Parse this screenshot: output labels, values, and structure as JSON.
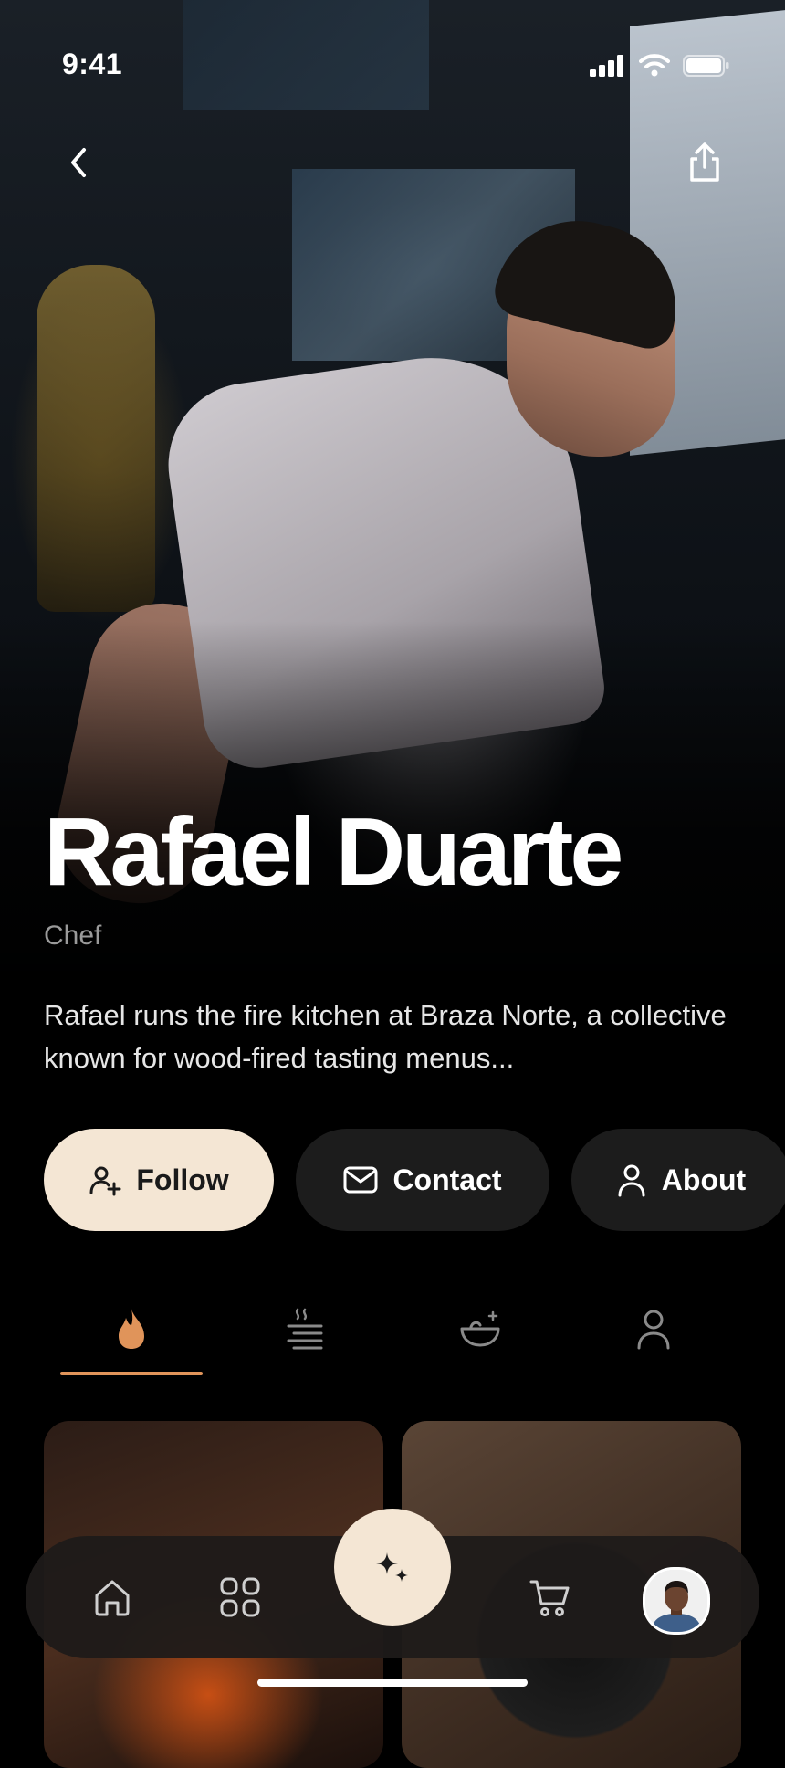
{
  "status_bar": {
    "time": "9:41"
  },
  "profile": {
    "name": "Rafael Duarte",
    "role": "Chef",
    "bio": "Rafael runs the fire kitchen at Braza Norte, a collective known for wood-fired tasting menus..."
  },
  "actions": [
    {
      "label": "Follow",
      "icon": "person-add-icon"
    },
    {
      "label": "Contact",
      "icon": "mail-icon"
    },
    {
      "label": "About",
      "icon": "person-icon"
    }
  ],
  "tabs": [
    {
      "icon": "flame-icon",
      "active": true
    },
    {
      "icon": "grill-icon",
      "active": false
    },
    {
      "icon": "bowl-icon",
      "active": false
    },
    {
      "icon": "person-icon",
      "active": false
    }
  ],
  "bottom_nav": [
    "home-icon",
    "grid-icon",
    "sparkles-icon",
    "cart-icon",
    "avatar"
  ],
  "colors": {
    "accent": "#e0945a",
    "cream": "#f4e6d4",
    "pill_dark": "#1c1c1c",
    "background": "#000000"
  }
}
